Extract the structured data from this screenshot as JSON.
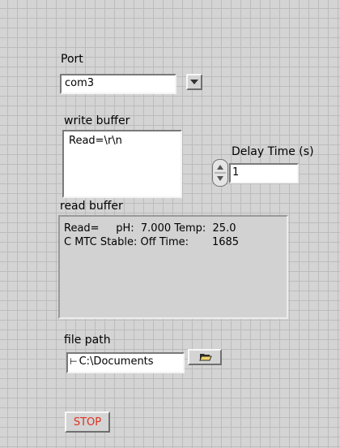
{
  "port": {
    "label": "Port",
    "value": "com3",
    "dropdown_icon": "dropdown-arrow-icon"
  },
  "write_buffer": {
    "label": "write buffer",
    "value": "Read=\\r\\n"
  },
  "delay_time": {
    "label": "Delay Time (s)",
    "value": "1",
    "spinner_icon": "up-down-spinner-icon"
  },
  "read_buffer": {
    "label": "read buffer",
    "lines": [
      "Read=     pH:  7.000 Temp:  25.0",
      "C MTC Stable: Off Time:       1685"
    ]
  },
  "file_path": {
    "label": "file path",
    "value": "C:\\Documents",
    "path_icon": "path-icon",
    "browse_icon": "folder-open-icon"
  },
  "stop_button": {
    "label": "STOP",
    "color": "#e0301e"
  }
}
